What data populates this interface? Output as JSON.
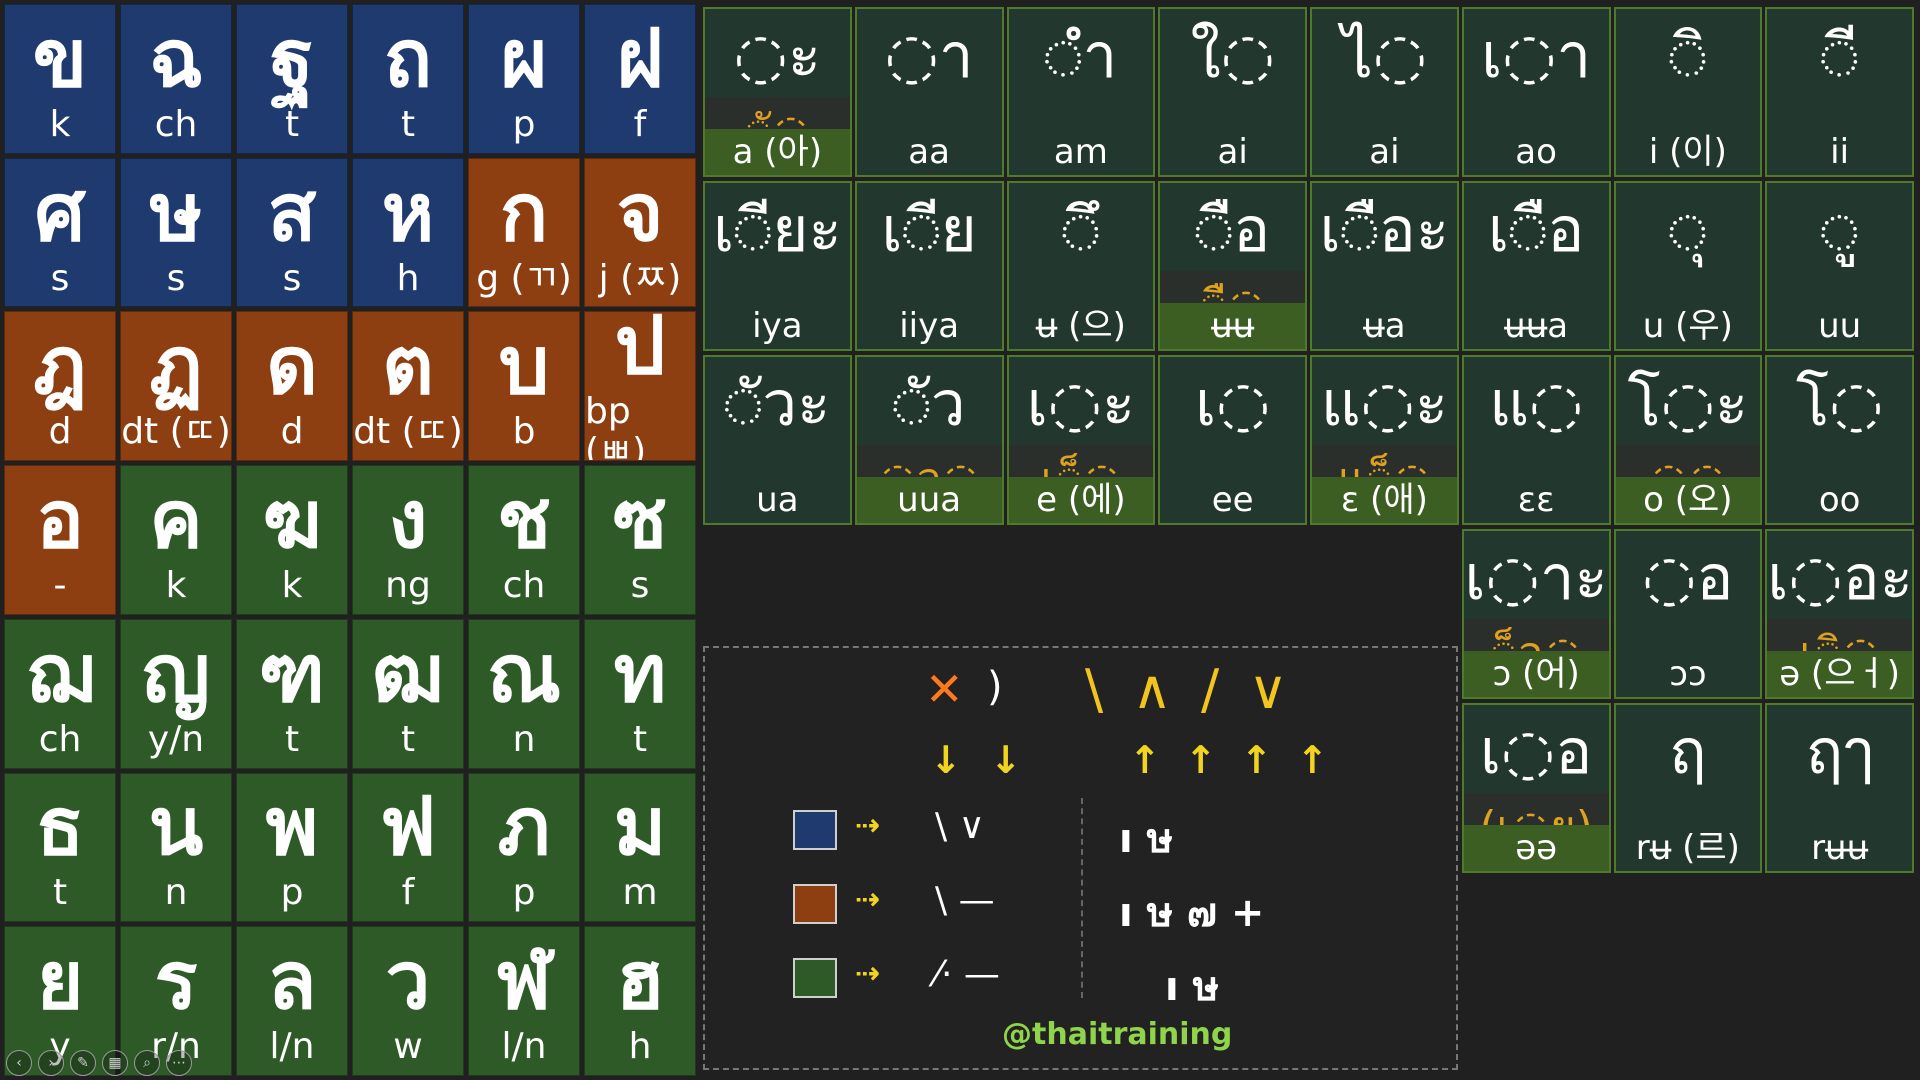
{
  "consonants": [
    {
      "glyph": "ข",
      "rom": "k",
      "cls": "high"
    },
    {
      "glyph": "ฉ",
      "rom": "ch",
      "cls": "high"
    },
    {
      "glyph": "ฐ",
      "rom": "t",
      "cls": "high"
    },
    {
      "glyph": "ถ",
      "rom": "t",
      "cls": "high"
    },
    {
      "glyph": "ผ",
      "rom": "p",
      "cls": "high"
    },
    {
      "glyph": "ฝ",
      "rom": "f",
      "cls": "high"
    },
    {
      "glyph": "ศ",
      "rom": "s",
      "cls": "high"
    },
    {
      "glyph": "ษ",
      "rom": "s",
      "cls": "high"
    },
    {
      "glyph": "ส",
      "rom": "s",
      "cls": "high"
    },
    {
      "glyph": "ห",
      "rom": "h",
      "cls": "high"
    },
    {
      "glyph": "ก",
      "rom": "g (ㄲ)",
      "cls": "mid"
    },
    {
      "glyph": "จ",
      "rom": "j (ㅉ)",
      "cls": "mid"
    },
    {
      "glyph": "ฎ",
      "rom": "d",
      "cls": "mid"
    },
    {
      "glyph": "ฏ",
      "rom": "dt (ㄸ)",
      "cls": "mid"
    },
    {
      "glyph": "ด",
      "rom": "d",
      "cls": "mid"
    },
    {
      "glyph": "ต",
      "rom": "dt (ㄸ)",
      "cls": "mid"
    },
    {
      "glyph": "บ",
      "rom": "b",
      "cls": "mid"
    },
    {
      "glyph": "ป",
      "rom": "bp (ㅃ)",
      "cls": "mid"
    },
    {
      "glyph": "อ",
      "rom": "-",
      "cls": "mid"
    },
    {
      "glyph": "ค",
      "rom": "k",
      "cls": "low"
    },
    {
      "glyph": "ฆ",
      "rom": "k",
      "cls": "low"
    },
    {
      "glyph": "ง",
      "rom": "ng",
      "cls": "low"
    },
    {
      "glyph": "ช",
      "rom": "ch",
      "cls": "low"
    },
    {
      "glyph": "ซ",
      "rom": "s",
      "cls": "low"
    },
    {
      "glyph": "ฌ",
      "rom": "ch",
      "cls": "low"
    },
    {
      "glyph": "ญ",
      "rom": "y/n",
      "cls": "low"
    },
    {
      "glyph": "ฑ",
      "rom": "t",
      "cls": "low"
    },
    {
      "glyph": "ฒ",
      "rom": "t",
      "cls": "low"
    },
    {
      "glyph": "ณ",
      "rom": "n",
      "cls": "low"
    },
    {
      "glyph": "ท",
      "rom": "t",
      "cls": "low"
    },
    {
      "glyph": "ธ",
      "rom": "t",
      "cls": "low"
    },
    {
      "glyph": "น",
      "rom": "n",
      "cls": "low"
    },
    {
      "glyph": "พ",
      "rom": "p",
      "cls": "low"
    },
    {
      "glyph": "ฟ",
      "rom": "f",
      "cls": "low"
    },
    {
      "glyph": "ภ",
      "rom": "p",
      "cls": "low"
    },
    {
      "glyph": "ม",
      "rom": "m",
      "cls": "low"
    },
    {
      "glyph": "ย",
      "rom": "y",
      "cls": "low"
    },
    {
      "glyph": "ร",
      "rom": "r/n",
      "cls": "low"
    },
    {
      "glyph": "ล",
      "rom": "l/n",
      "cls": "low"
    },
    {
      "glyph": "ว",
      "rom": "w",
      "cls": "low"
    },
    {
      "glyph": "ฬ",
      "rom": "l/n",
      "cls": "low"
    },
    {
      "glyph": "ฮ",
      "rom": "h",
      "cls": "low"
    }
  ],
  "vowels": [
    {
      "glyph": "◌ะ",
      "short": "◌ั◌",
      "label": "a (아)"
    },
    {
      "glyph": "◌า",
      "label": "aa"
    },
    {
      "glyph": "◌ำ",
      "label": "am"
    },
    {
      "glyph": "ใ◌",
      "label": "ai"
    },
    {
      "glyph": "ไ◌",
      "label": "ai"
    },
    {
      "glyph": "เ◌า",
      "label": "ao"
    },
    {
      "glyph": "◌ิ",
      "label": "i (이)",
      "mark": true
    },
    {
      "glyph": "◌ี",
      "label": "ii",
      "mark": true
    },
    {
      "glyph": "เ◌ียะ",
      "label": "iya",
      "mark": true
    },
    {
      "glyph": "เ◌ีย",
      "label": "iiya",
      "mark": true
    },
    {
      "glyph": "◌ึ",
      "label": "ʉ (으)"
    },
    {
      "glyph": "◌ือ",
      "short": "◌ื◌",
      "label": "ʉʉ",
      "mark": true
    },
    {
      "glyph": "เ◌ือะ",
      "label": "ʉa",
      "mark": true
    },
    {
      "glyph": "เ◌ือ",
      "label": "ʉʉa",
      "mark": true
    },
    {
      "glyph": "◌ุ",
      "label": "u (우)"
    },
    {
      "glyph": "◌ู",
      "label": "uu"
    },
    {
      "glyph": "◌ัวะ",
      "label": "ua"
    },
    {
      "glyph": "◌ัว",
      "short": "◌ว◌",
      "label": "uua"
    },
    {
      "glyph": "เ◌ะ",
      "short": "เ◌็◌",
      "label": "e (에)"
    },
    {
      "glyph": "เ◌",
      "label": "ee"
    },
    {
      "glyph": "แ◌ะ",
      "short": "แ◌็◌",
      "label": "ɛ (애)"
    },
    {
      "glyph": "แ◌",
      "label": "ɛɛ"
    },
    {
      "glyph": "โ◌ะ",
      "short": "◌◌",
      "label": "o (오)"
    },
    {
      "glyph": "โ◌",
      "label": "oo"
    },
    {
      "glyph": "เ◌าะ",
      "short": "◌็อ◌",
      "label": "ɔ (어)"
    },
    {
      "glyph": "◌อ",
      "label": "ɔɔ"
    },
    {
      "glyph": "เ◌อะ",
      "short": "เ◌ิ◌",
      "label": "ə (으ㅓ)"
    },
    {
      "glyph": "เ◌อ",
      "short": "(เ◌ย)",
      "label": "əə"
    },
    {
      "glyph": "ฤ",
      "label": "rʉ (르)"
    },
    {
      "glyph": "ฤๅ",
      "label": "rʉʉ"
    }
  ],
  "legend": {
    "top_marks": "\\ ∧ / ∨",
    "rows": [
      {
        "color": "#1e3a6e",
        "tones": "\\ ∨",
        "marks": "ı ษ"
      },
      {
        "color": "#8e3f12",
        "tones": "\\ —",
        "marks": "ı ษ ๗ +"
      },
      {
        "color": "#2e5a28",
        "tones": "⁄· —",
        "marks": "ı ษ"
      }
    ],
    "handle": "@thaitraining"
  },
  "colors": {
    "high": "#1e3a6e",
    "mid": "#8e3f12",
    "low": "#2e5a28"
  }
}
